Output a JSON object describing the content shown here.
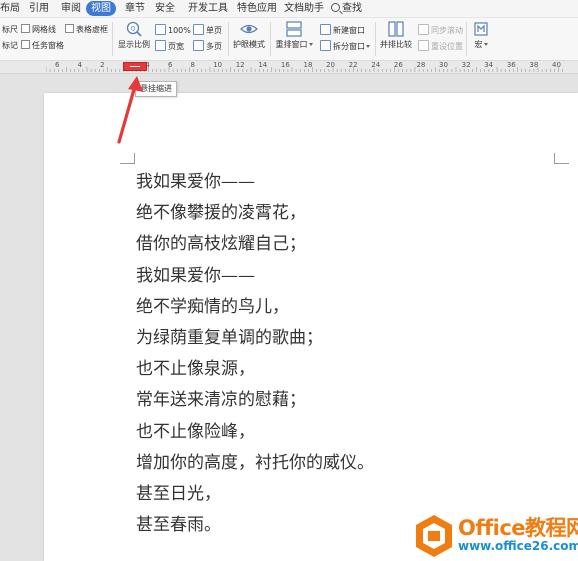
{
  "menu": {
    "items": [
      "布局",
      "引用",
      "审阅",
      "视图",
      "章节",
      "安全",
      "开发工具",
      "特色应用",
      "文档助手"
    ],
    "active": "视图",
    "search_label": "查找"
  },
  "ribbon": {
    "ruler_label": "标尺",
    "gridlines_label": "网格线",
    "table_borders_label": "表格虚框",
    "mark_label": "标记",
    "task_pane_label": "任务窗格",
    "zoom_label": "显示比例",
    "zoom_100_label": "100%",
    "page_width_label": "页宽",
    "single_page_label": "单页",
    "multi_page_label": "多页",
    "eye_protection_label": "护眼模式",
    "rearrange_windows_label": "重排窗口",
    "new_window_label": "新建窗口",
    "split_window_label": "拆分窗口",
    "side_by_side_label": "并排比较",
    "sync_scroll_label": "同步滚动",
    "reset_position_label": "重设位置",
    "macro_label": "宏"
  },
  "ruler": {
    "labels": [
      "6",
      "4",
      "2",
      "2",
      "4",
      "6",
      "8",
      "10",
      "12",
      "14",
      "16",
      "18",
      "20",
      "22",
      "24",
      "26",
      "28",
      "30",
      "32",
      "34",
      "36",
      "38",
      "40"
    ]
  },
  "tooltip": {
    "text": "悬挂缩进"
  },
  "document": {
    "lines": [
      "我如果爱你——",
      "绝不像攀援的凌霄花，",
      "借你的高枝炫耀自己；",
      "我如果爱你——",
      "绝不学痴情的鸟儿，",
      "为绿荫重复单调的歌曲；",
      "也不止像泉源，",
      "常年送来清凉的慰藉；",
      "也不止像险峰，",
      "增加你的高度，衬托你的威仪。",
      "甚至日光，",
      "甚至春雨。"
    ]
  },
  "watermark": {
    "title": "Office教程网",
    "url": "www.office26.com"
  },
  "colors": {
    "active_tab": "#3e79d6",
    "arrow": "#e33b3b",
    "watermark_orange": "#ef7d12",
    "watermark_blue": "#1a8fd0"
  }
}
